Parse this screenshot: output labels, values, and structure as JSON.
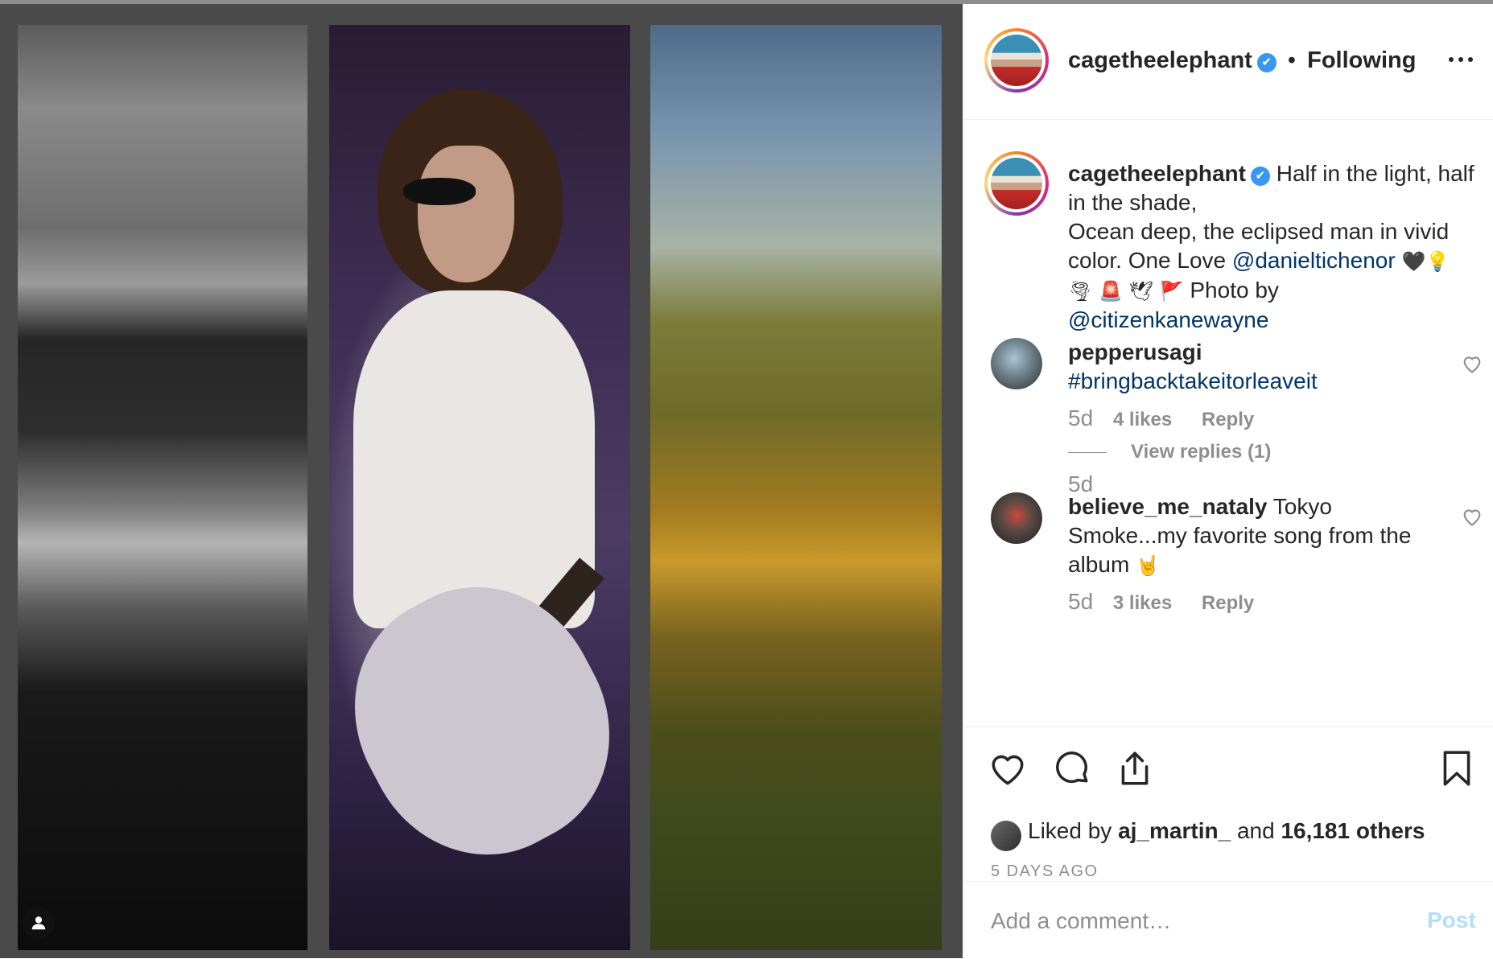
{
  "post": {
    "account": "cagetheelephant",
    "separator": "•",
    "follow_status": "Following",
    "verified_mark": "✔"
  },
  "caption": {
    "username": "cagetheelephant",
    "text_1": "Half in the light, half in the shade,",
    "text_2": "Ocean deep, the eclipsed man in vivid color. One Love",
    "mention_1": "@danieltichenor",
    "emojis": "🖤💡 🌪 🚨 🕊 🚩",
    "text_3": "Photo by",
    "mention_2": "@citizenkanewayne",
    "time": "5d"
  },
  "comments": [
    {
      "username": "pepperusagi",
      "text": "",
      "hashtag": "#bringbacktakeitorleaveit",
      "time": "5d",
      "likes": "4 likes",
      "reply": "Reply",
      "view_replies": "View replies (1)"
    },
    {
      "username": "believe_me_nataly",
      "text": "Tokyo Smoke...my favorite song from the album",
      "emoji": "🤘",
      "time": "5d",
      "likes": "3 likes",
      "reply": "Reply"
    }
  ],
  "likes": {
    "prefix": "Liked by",
    "user": "aj_martin_",
    "joiner": "and",
    "others": "16,181 others"
  },
  "date": "5 DAYS AGO",
  "add_comment": {
    "placeholder": "Add a comment…",
    "post_label": "Post"
  },
  "colors": {
    "link": "#003569",
    "verified": "#3897f0",
    "post_disabled": "#b2dffc",
    "muted": "#8e8e8e"
  },
  "icons": [
    "heart-icon",
    "comment-icon",
    "share-icon",
    "bookmark-icon",
    "more-icon",
    "user-tag-icon",
    "verified-icon"
  ]
}
